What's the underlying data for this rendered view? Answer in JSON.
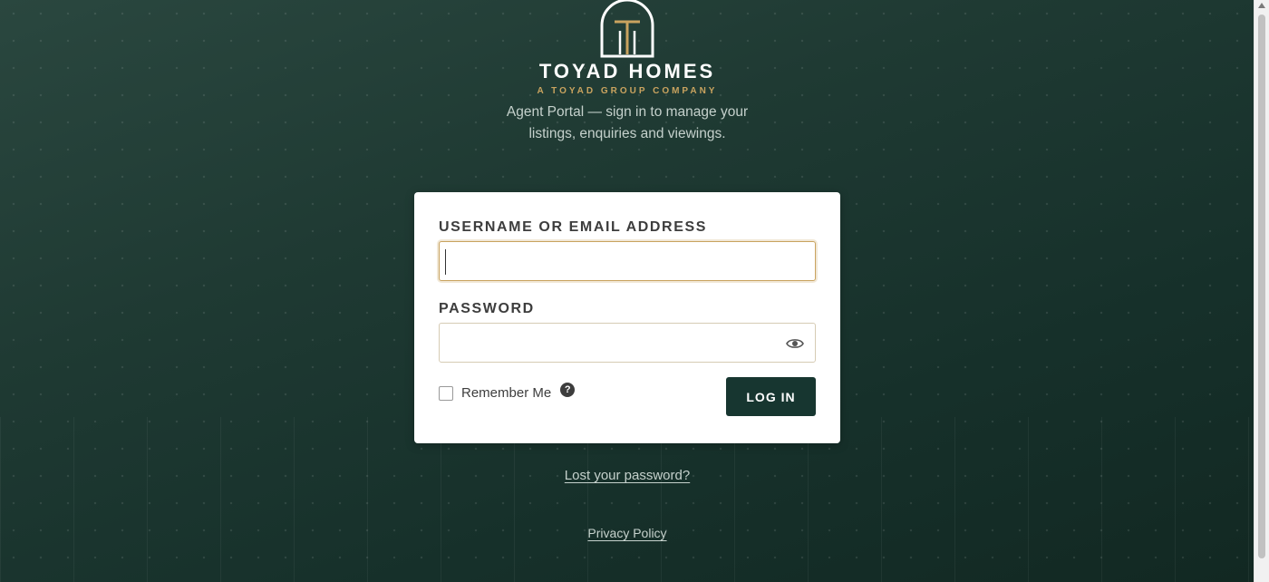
{
  "brand": {
    "name": "TOYAD HOMES",
    "tagline": "A TOYAD GROUP COMPANY",
    "description": "Agent Portal — sign in to manage your listings, enquiries and viewings."
  },
  "form": {
    "username_label": "USERNAME OR EMAIL ADDRESS",
    "username_value": "",
    "password_label": "PASSWORD",
    "password_value": "",
    "remember_label": "Remember Me",
    "remember_checked": false,
    "help_glyph": "?",
    "login_label": "LOG IN",
    "show_password_icon": "eye-icon"
  },
  "links": {
    "lost_password": "Lost your password?",
    "privacy_policy": "Privacy Policy"
  },
  "colors": {
    "background": "#1f3a33",
    "accent_gold": "#c9a35f",
    "button": "#173630"
  }
}
